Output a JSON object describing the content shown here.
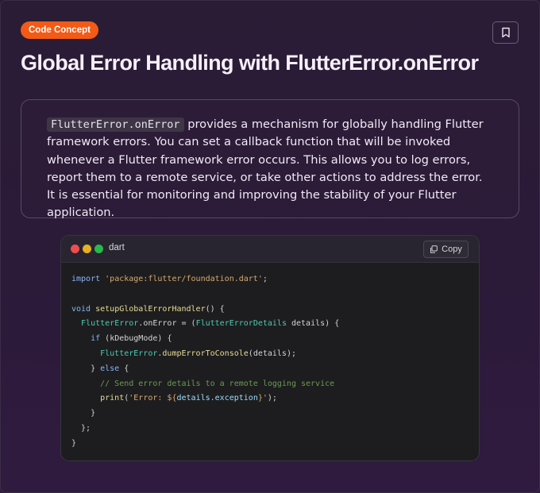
{
  "badge": {
    "label": "Code Concept"
  },
  "header": {
    "title": "Global Error Handling with FlutterError.onError"
  },
  "description": {
    "inline_code": "FlutterError.onError",
    "text": " provides a mechanism for globally handling Flutter framework errors. You can set a callback function that will be invoked whenever a Flutter framework error occurs. This allows you to log errors, report them to a remote service, or take other actions to address the error. It is essential for monitoring and improving the stability of your Flutter application."
  },
  "code_block": {
    "language": "dart",
    "copy_label": "Copy",
    "tokens": {
      "import": "import",
      "import_path": "'package:flutter/foundation.dart'",
      "void": "void",
      "fn_name": "setupGlobalErrorHandler",
      "flutter_error": "FlutterError",
      "on_error": "onError",
      "details_type": "FlutterErrorDetails",
      "details": "details",
      "if": "if",
      "kdebug": "kDebugMode",
      "dump": "dumpErrorToConsole",
      "else": "else",
      "comment": "// Send error details to a remote logging service",
      "print": "print",
      "print_str_open": "'Error: ${",
      "exception": "details.exception",
      "print_str_close": "}'"
    }
  },
  "colors": {
    "badge_bg": "#f25a16",
    "keyword": "#8ab4f8",
    "string": "#d7a86f",
    "function": "#e6dc95",
    "class": "#4ec9b0",
    "comment": "#6a9955"
  },
  "icons": {
    "bookmark": "bookmark-icon",
    "copy": "copy-icon"
  }
}
